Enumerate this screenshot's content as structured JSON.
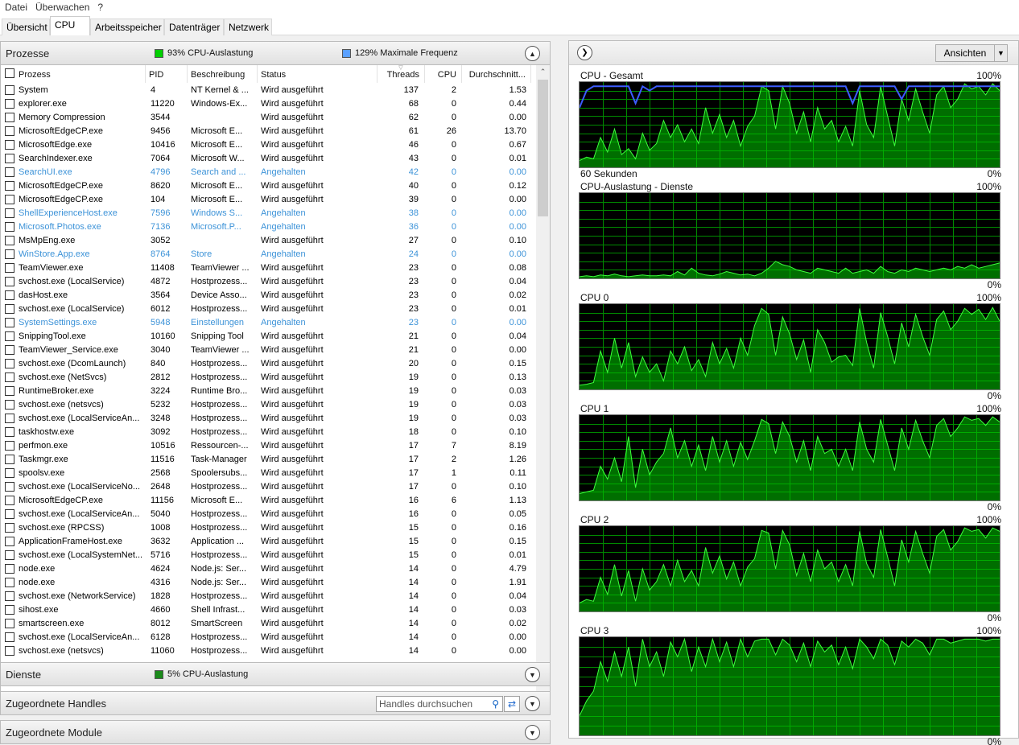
{
  "menu": [
    "Datei",
    "Überwachen",
    "?"
  ],
  "tabs": [
    "Übersicht",
    "CPU",
    "Arbeitsspeicher",
    "Datenträger",
    "Netzwerk"
  ],
  "active_tab": "CPU",
  "processes_section": {
    "title": "Prozesse",
    "cpu_usage": "93% CPU-Auslastung",
    "max_freq": "129% Maximale Frequenz",
    "cpu_color": "#00d000",
    "freq_color": "#5aa0ff"
  },
  "columns": [
    "Prozess",
    "PID",
    "Beschreibung",
    "Status",
    "Threads",
    "CPU",
    "Durchschnitt..."
  ],
  "rows": [
    [
      "System",
      "4",
      "NT Kernel & ...",
      "Wird ausgeführt",
      "137",
      "2",
      "1.53",
      false
    ],
    [
      "explorer.exe",
      "11220",
      "Windows-Ex...",
      "Wird ausgeführt",
      "68",
      "0",
      "0.44",
      false
    ],
    [
      "Memory Compression",
      "3544",
      "",
      "Wird ausgeführt",
      "62",
      "0",
      "0.00",
      false
    ],
    [
      "MicrosoftEdgeCP.exe",
      "9456",
      "Microsoft E...",
      "Wird ausgeführt",
      "61",
      "26",
      "13.70",
      false
    ],
    [
      "MicrosoftEdge.exe",
      "10416",
      "Microsoft E...",
      "Wird ausgeführt",
      "46",
      "0",
      "0.67",
      false
    ],
    [
      "SearchIndexer.exe",
      "7064",
      "Microsoft W...",
      "Wird ausgeführt",
      "43",
      "0",
      "0.01",
      false
    ],
    [
      "SearchUI.exe",
      "4796",
      "Search and ...",
      "Angehalten",
      "42",
      "0",
      "0.00",
      true
    ],
    [
      "MicrosoftEdgeCP.exe",
      "8620",
      "Microsoft E...",
      "Wird ausgeführt",
      "40",
      "0",
      "0.12",
      false
    ],
    [
      "MicrosoftEdgeCP.exe",
      "104",
      "Microsoft E...",
      "Wird ausgeführt",
      "39",
      "0",
      "0.00",
      false
    ],
    [
      "ShellExperienceHost.exe",
      "7596",
      "Windows S...",
      "Angehalten",
      "38",
      "0",
      "0.00",
      true
    ],
    [
      "Microsoft.Photos.exe",
      "7136",
      "Microsoft.P...",
      "Angehalten",
      "36",
      "0",
      "0.00",
      true
    ],
    [
      "MsMpEng.exe",
      "3052",
      "",
      "Wird ausgeführt",
      "27",
      "0",
      "0.10",
      false
    ],
    [
      "WinStore.App.exe",
      "8764",
      "Store",
      "Angehalten",
      "24",
      "0",
      "0.00",
      true
    ],
    [
      "TeamViewer.exe",
      "11408",
      "TeamViewer ...",
      "Wird ausgeführt",
      "23",
      "0",
      "0.08",
      false
    ],
    [
      "svchost.exe (LocalService)",
      "4872",
      "Hostprozess...",
      "Wird ausgeführt",
      "23",
      "0",
      "0.04",
      false
    ],
    [
      "dasHost.exe",
      "3564",
      "Device Asso...",
      "Wird ausgeführt",
      "23",
      "0",
      "0.02",
      false
    ],
    [
      "svchost.exe (LocalService)",
      "6012",
      "Hostprozess...",
      "Wird ausgeführt",
      "23",
      "0",
      "0.01",
      false
    ],
    [
      "SystemSettings.exe",
      "5948",
      "Einstellungen",
      "Angehalten",
      "23",
      "0",
      "0.00",
      true
    ],
    [
      "SnippingTool.exe",
      "10160",
      "Snipping Tool",
      "Wird ausgeführt",
      "21",
      "0",
      "0.04",
      false
    ],
    [
      "TeamViewer_Service.exe",
      "3040",
      "TeamViewer ...",
      "Wird ausgeführt",
      "21",
      "0",
      "0.00",
      false
    ],
    [
      "svchost.exe (DcomLaunch)",
      "840",
      "Hostprozess...",
      "Wird ausgeführt",
      "20",
      "0",
      "0.15",
      false
    ],
    [
      "svchost.exe (NetSvcs)",
      "2812",
      "Hostprozess...",
      "Wird ausgeführt",
      "19",
      "0",
      "0.13",
      false
    ],
    [
      "RuntimeBroker.exe",
      "3224",
      "Runtime Bro...",
      "Wird ausgeführt",
      "19",
      "0",
      "0.03",
      false
    ],
    [
      "svchost.exe (netsvcs)",
      "5232",
      "Hostprozess...",
      "Wird ausgeführt",
      "19",
      "0",
      "0.03",
      false
    ],
    [
      "svchost.exe (LocalServiceAn...",
      "3248",
      "Hostprozess...",
      "Wird ausgeführt",
      "19",
      "0",
      "0.03",
      false
    ],
    [
      "taskhostw.exe",
      "3092",
      "Hostprozess...",
      "Wird ausgeführt",
      "18",
      "0",
      "0.10",
      false
    ],
    [
      "perfmon.exe",
      "10516",
      "Ressourcen-...",
      "Wird ausgeführt",
      "17",
      "7",
      "8.19",
      false
    ],
    [
      "Taskmgr.exe",
      "11516",
      "Task-Manager",
      "Wird ausgeführt",
      "17",
      "2",
      "1.26",
      false
    ],
    [
      "spoolsv.exe",
      "2568",
      "Spoolersubs...",
      "Wird ausgeführt",
      "17",
      "1",
      "0.11",
      false
    ],
    [
      "svchost.exe (LocalServiceNo...",
      "2648",
      "Hostprozess...",
      "Wird ausgeführt",
      "17",
      "0",
      "0.10",
      false
    ],
    [
      "MicrosoftEdgeCP.exe",
      "11156",
      "Microsoft E...",
      "Wird ausgeführt",
      "16",
      "6",
      "1.13",
      false
    ],
    [
      "svchost.exe (LocalServiceAn...",
      "5040",
      "Hostprozess...",
      "Wird ausgeführt",
      "16",
      "0",
      "0.05",
      false
    ],
    [
      "svchost.exe (RPCSS)",
      "1008",
      "Hostprozess...",
      "Wird ausgeführt",
      "15",
      "0",
      "0.16",
      false
    ],
    [
      "ApplicationFrameHost.exe",
      "3632",
      "Application ...",
      "Wird ausgeführt",
      "15",
      "0",
      "0.15",
      false
    ],
    [
      "svchost.exe (LocalSystemNet...",
      "5716",
      "Hostprozess...",
      "Wird ausgeführt",
      "15",
      "0",
      "0.01",
      false
    ],
    [
      "node.exe",
      "4624",
      "Node.js: Ser...",
      "Wird ausgeführt",
      "14",
      "0",
      "4.79",
      false
    ],
    [
      "node.exe",
      "4316",
      "Node.js: Ser...",
      "Wird ausgeführt",
      "14",
      "0",
      "1.91",
      false
    ],
    [
      "svchost.exe (NetworkService)",
      "1828",
      "Hostprozess...",
      "Wird ausgeführt",
      "14",
      "0",
      "0.04",
      false
    ],
    [
      "sihost.exe",
      "4660",
      "Shell Infrast...",
      "Wird ausgeführt",
      "14",
      "0",
      "0.03",
      false
    ],
    [
      "smartscreen.exe",
      "8012",
      "SmartScreen",
      "Wird ausgeführt",
      "14",
      "0",
      "0.02",
      false
    ],
    [
      "svchost.exe (LocalServiceAn...",
      "6128",
      "Hostprozess...",
      "Wird ausgeführt",
      "14",
      "0",
      "0.00",
      false
    ],
    [
      "svchost.exe (netsvcs)",
      "11060",
      "Hostprozess...",
      "Wird ausgeführt",
      "14",
      "0",
      "0.00",
      false
    ]
  ],
  "services_section": {
    "title": "Dienste",
    "cpu_usage": "5% CPU-Auslastung"
  },
  "handles_section": {
    "title": "Zugeordnete Handles",
    "search_placeholder": "Handles durchsuchen"
  },
  "modules_section": {
    "title": "Zugeordnete Module"
  },
  "right_toolbar": {
    "views_label": "Ansichten"
  },
  "graphs": [
    {
      "title": "CPU - Gesamt",
      "max": "100%",
      "min": "0%",
      "caption": "60 Sekunden",
      "values": [
        8,
        12,
        10,
        35,
        18,
        45,
        15,
        22,
        10,
        40,
        20,
        28,
        55,
        35,
        50,
        30,
        45,
        28,
        70,
        40,
        62,
        35,
        55,
        25,
        48,
        60,
        95,
        90,
        45,
        95,
        75,
        40,
        65,
        30,
        70,
        45,
        55,
        30,
        48,
        25,
        90,
        50,
        35,
        95,
        60,
        25,
        80,
        55,
        92,
        65,
        40,
        85,
        95,
        70,
        80,
        98,
        92,
        95,
        85,
        98,
        90
      ],
      "freq": [
        70,
        90,
        95,
        95,
        95,
        95,
        95,
        95,
        75,
        95,
        90,
        95,
        95,
        95,
        95,
        95,
        95,
        95,
        95,
        95,
        95,
        95,
        95,
        95,
        95,
        95,
        95,
        95,
        95,
        95,
        95,
        95,
        95,
        95,
        95,
        95,
        95,
        95,
        95,
        75,
        95,
        95,
        95,
        95,
        95,
        95,
        80,
        95,
        95,
        95,
        95,
        95,
        95,
        95,
        95,
        95,
        95,
        95,
        95,
        95,
        95
      ]
    },
    {
      "title": "CPU-Auslastung - Dienste",
      "max": "100%",
      "min": "0%",
      "values": [
        2,
        3,
        2,
        4,
        3,
        5,
        3,
        2,
        3,
        4,
        3,
        3,
        4,
        3,
        8,
        4,
        12,
        6,
        4,
        3,
        5,
        8,
        6,
        4,
        5,
        3,
        6,
        12,
        20,
        16,
        14,
        10,
        8,
        6,
        12,
        10,
        8,
        6,
        12,
        6,
        8,
        10,
        6,
        14,
        8,
        6,
        10,
        8,
        12,
        10,
        8,
        10,
        12,
        10,
        14,
        12,
        16,
        12,
        14,
        16,
        18
      ]
    },
    {
      "title": "CPU 0",
      "max": "100%",
      "min": "0%",
      "values": [
        5,
        6,
        8,
        45,
        20,
        60,
        25,
        55,
        15,
        38,
        20,
        30,
        10,
        45,
        30,
        50,
        22,
        35,
        15,
        55,
        30,
        48,
        25,
        60,
        40,
        75,
        95,
        88,
        40,
        85,
        65,
        35,
        58,
        20,
        70,
        55,
        32,
        38,
        40,
        28,
        95,
        55,
        25,
        90,
        62,
        30,
        78,
        50,
        88,
        62,
        40,
        82,
        92,
        70,
        80,
        95,
        88,
        94,
        82,
        96,
        80
      ]
    },
    {
      "title": "CPU 1",
      "max": "100%",
      "min": "0%",
      "values": [
        8,
        10,
        12,
        40,
        25,
        50,
        22,
        75,
        15,
        60,
        30,
        45,
        55,
        85,
        50,
        70,
        40,
        65,
        35,
        75,
        45,
        70,
        40,
        68,
        48,
        70,
        95,
        90,
        55,
        92,
        75,
        45,
        70,
        35,
        75,
        55,
        60,
        40,
        60,
        35,
        92,
        60,
        45,
        95,
        65,
        35,
        85,
        60,
        94,
        70,
        50,
        88,
        96,
        75,
        85,
        98,
        94,
        96,
        88,
        98,
        92
      ]
    },
    {
      "title": "CPU 2",
      "max": "100%",
      "min": "0%",
      "values": [
        10,
        14,
        12,
        40,
        20,
        55,
        18,
        48,
        12,
        50,
        25,
        35,
        55,
        30,
        60,
        35,
        48,
        30,
        75,
        45,
        65,
        38,
        58,
        30,
        52,
        62,
        95,
        92,
        50,
        95,
        78,
        42,
        68,
        35,
        72,
        50,
        58,
        35,
        55,
        30,
        94,
        56,
        40,
        96,
        64,
        30,
        84,
        58,
        94,
        68,
        45,
        88,
        96,
        72,
        82,
        98,
        94,
        96,
        86,
        98,
        94
      ]
    },
    {
      "title": "CPU 3",
      "max": "100%",
      "min": "0%",
      "values": [
        20,
        35,
        45,
        75,
        55,
        85,
        60,
        90,
        50,
        98,
        70,
        85,
        60,
        95,
        80,
        98,
        65,
        90,
        70,
        98,
        75,
        95,
        70,
        98,
        80,
        96,
        98,
        98,
        82,
        98,
        92,
        75,
        94,
        70,
        96,
        85,
        92,
        72,
        90,
        68,
        98,
        90,
        78,
        98,
        92,
        72,
        96,
        90,
        98,
        94,
        82,
        98,
        98,
        94,
        96,
        98,
        98,
        98,
        96,
        98,
        98
      ]
    }
  ]
}
